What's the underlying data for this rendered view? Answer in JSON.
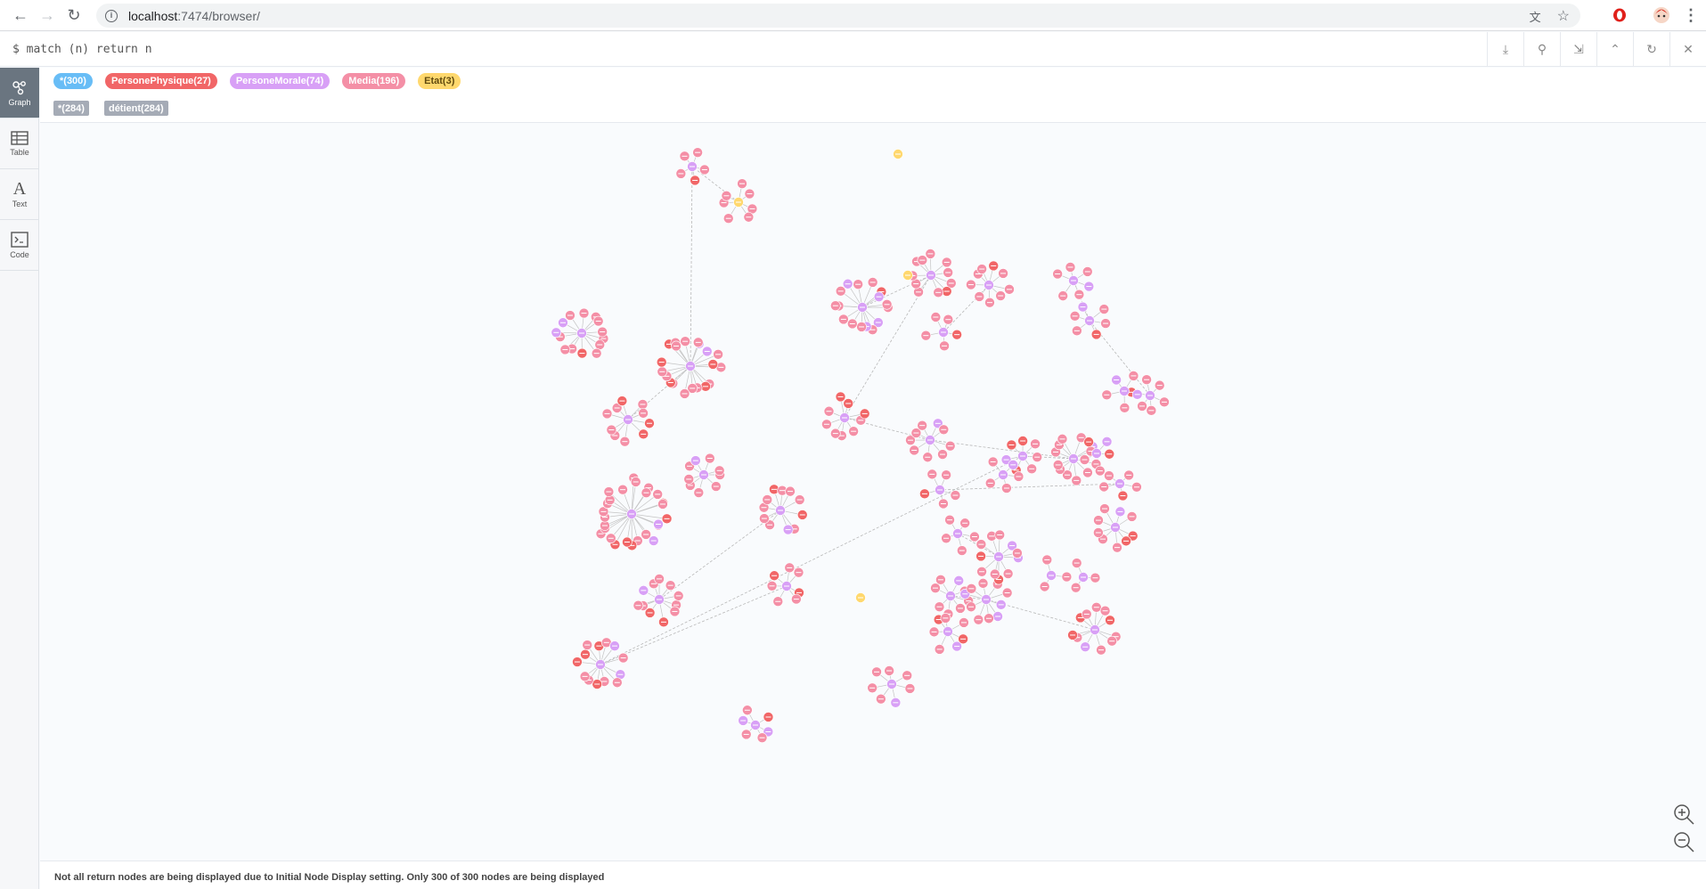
{
  "browser": {
    "url_host": "localhost",
    "url_port_path": ":7474/browser/"
  },
  "editor": {
    "query": "$ match (n) return n"
  },
  "sidebar": {
    "items": [
      {
        "label": "Graph",
        "icon": "graph-icon"
      },
      {
        "label": "Table",
        "icon": "table-icon"
      },
      {
        "label": "Text",
        "icon": "text-icon"
      },
      {
        "label": "Code",
        "icon": "code-icon"
      }
    ]
  },
  "legend": {
    "labels": [
      {
        "text": "*(300)",
        "color": "#68bdf6"
      },
      {
        "text": "PersonePhysique(27)",
        "color": "#f16667"
      },
      {
        "text": "PersoneMorale(74)",
        "color": "#d8a0f6"
      },
      {
        "text": "Media(196)",
        "color": "#f48fa6"
      },
      {
        "text": "Etat(3)",
        "color": "#ffd86e"
      }
    ],
    "relationships": [
      {
        "text": "*(284)"
      },
      {
        "text": "détient(284)"
      }
    ]
  },
  "status": {
    "message": "Not all return nodes are being displayed due to Initial Node Display setting. Only 300 of 300 nodes are being displayed"
  },
  "colors": {
    "PersonePhysique": "#f16667",
    "PersoneMorale": "#d8a0f6",
    "Media": "#f48fa6",
    "Etat": "#ffd86e"
  }
}
